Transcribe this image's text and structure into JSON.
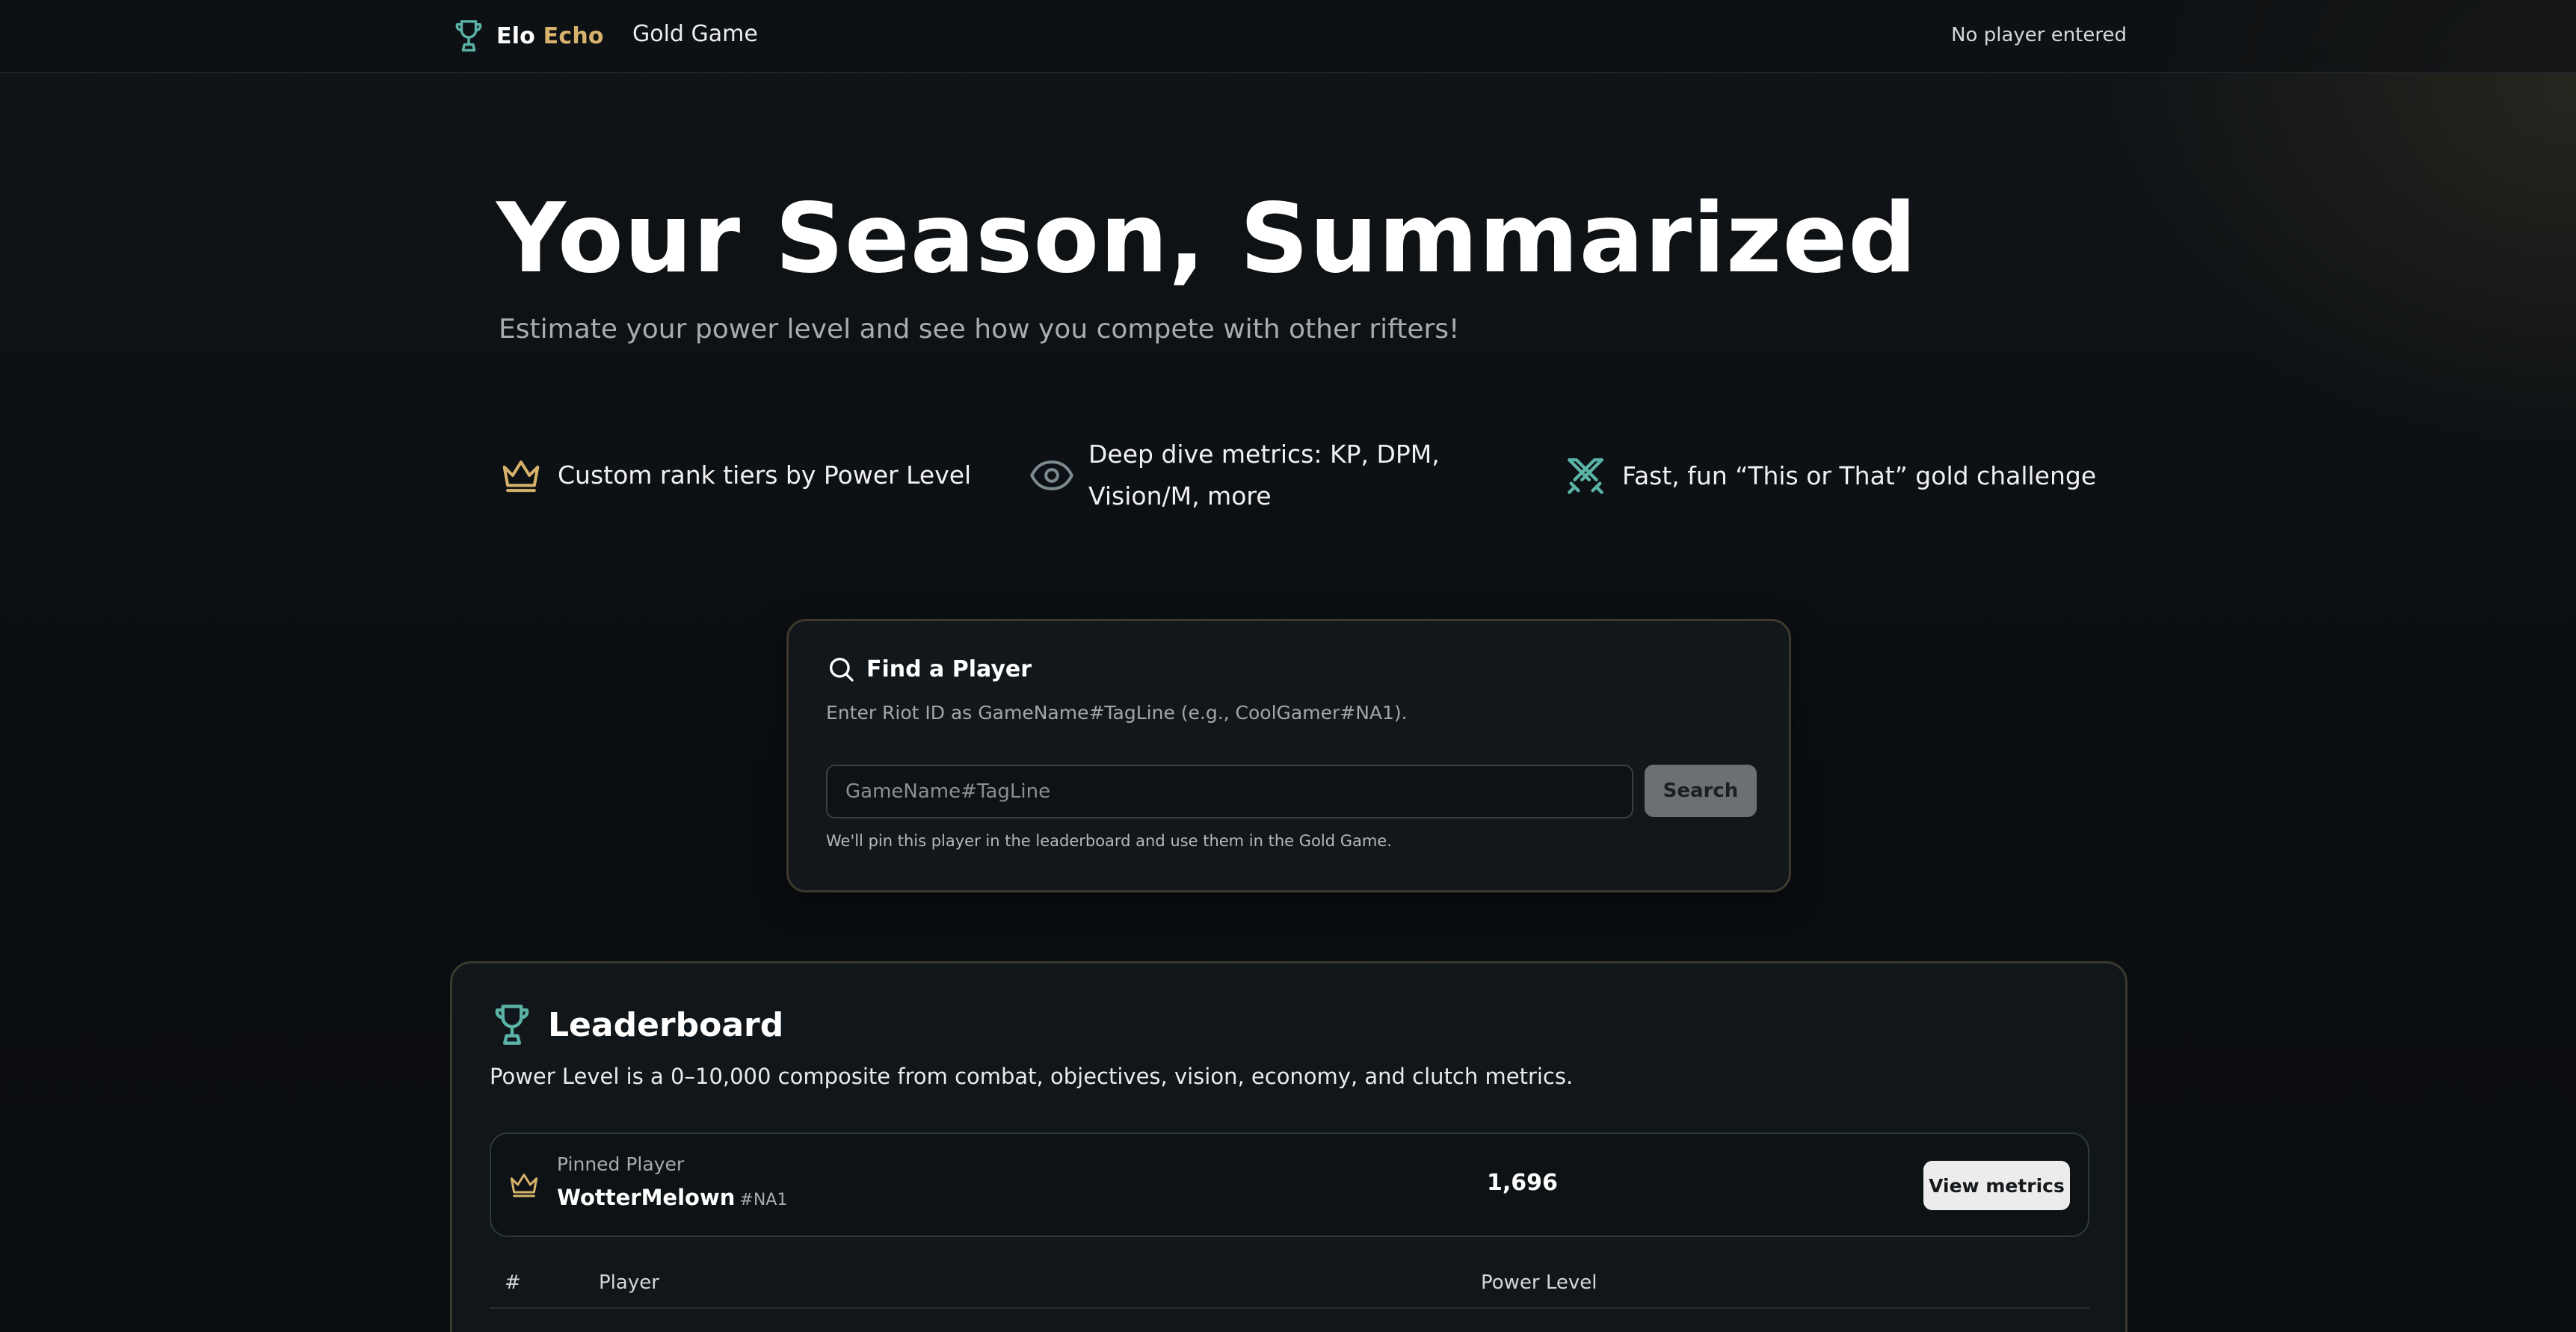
{
  "nav": {
    "brand_part1": "Elo",
    "brand_part2": "Echo",
    "link_gold_game": "Gold Game",
    "player_status": "No player entered"
  },
  "hero": {
    "title": "Your Season, Summarized",
    "subtitle": "Estimate your power level and see how you compete with other rifters!"
  },
  "features": [
    {
      "icon": "crown-icon",
      "text": "Custom rank tiers by Power Level"
    },
    {
      "icon": "eye-icon",
      "text": "Deep dive metrics: KP, DPM, Vision/M, more"
    },
    {
      "icon": "crossed-swords-icon",
      "text": "Fast, fun “This or That” gold challenge"
    }
  ],
  "search": {
    "title": "Find a Player",
    "hint": "Enter Riot ID as GameName#TagLine (e.g., CoolGamer#NA1).",
    "placeholder": "GameName#TagLine",
    "value": "",
    "button": "Search",
    "note": "We'll pin this player in the leaderboard and use them in the Gold Game."
  },
  "leaderboard": {
    "title": "Leaderboard",
    "description": "Power Level is a 0–10,000 composite from combat, objectives, vision, economy, and clutch metrics.",
    "pinned": {
      "label": "Pinned Player",
      "name": "WotterMelown",
      "tag": "#NA1",
      "power_level": "1,696",
      "button": "View metrics"
    },
    "columns": {
      "rank": "#",
      "player": "Player",
      "power_level": "Power Level"
    }
  },
  "colors": {
    "accent_gold": "#d7b26c",
    "accent_teal": "#5ab3a6",
    "background": "#0c0f12"
  }
}
